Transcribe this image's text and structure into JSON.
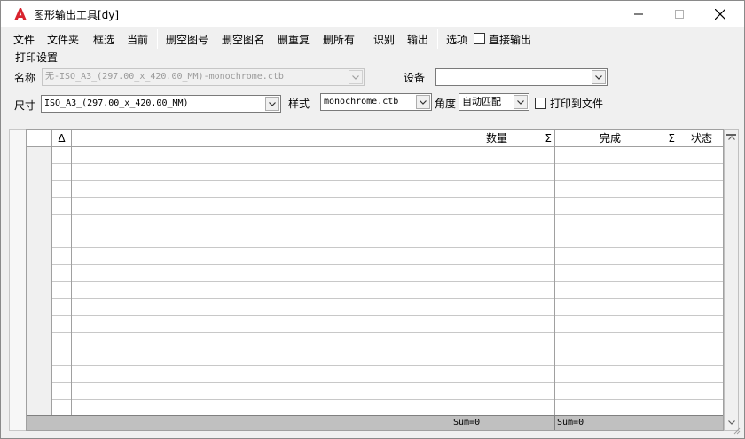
{
  "window": {
    "title": "图形输出工具[dy]",
    "minimize_glyph": "—",
    "maximize_glyph": "☐",
    "close_glyph": "✕"
  },
  "menu": {
    "items": [
      "文件",
      "文件夹",
      "框选",
      "当前",
      "删空图号",
      "删空图名",
      "删重复",
      "删所有",
      "识别",
      "输出",
      "选项"
    ],
    "direct_output_label": "直接输出"
  },
  "print_settings": {
    "group_label": "打印设置",
    "name_label": "名称",
    "name_value": "无-ISO_A3_(297.00_x_420.00_MM)-monochrome.ctb",
    "device_label": "设备",
    "device_value": "",
    "size_label": "尺寸",
    "size_value": "ISO_A3_(297.00_x_420.00_MM)",
    "style_label": "样式",
    "style_value": "monochrome.ctb",
    "angle_label": "角度",
    "angle_value": "自动匹配",
    "print_to_file_label": "打印到文件"
  },
  "grid": {
    "columns": [
      "Δ",
      "",
      "数量",
      "Σ",
      "完成",
      "Σ",
      "状态"
    ],
    "footer": [
      "Sum=0",
      "Sum=0"
    ],
    "row_count": 16
  }
}
